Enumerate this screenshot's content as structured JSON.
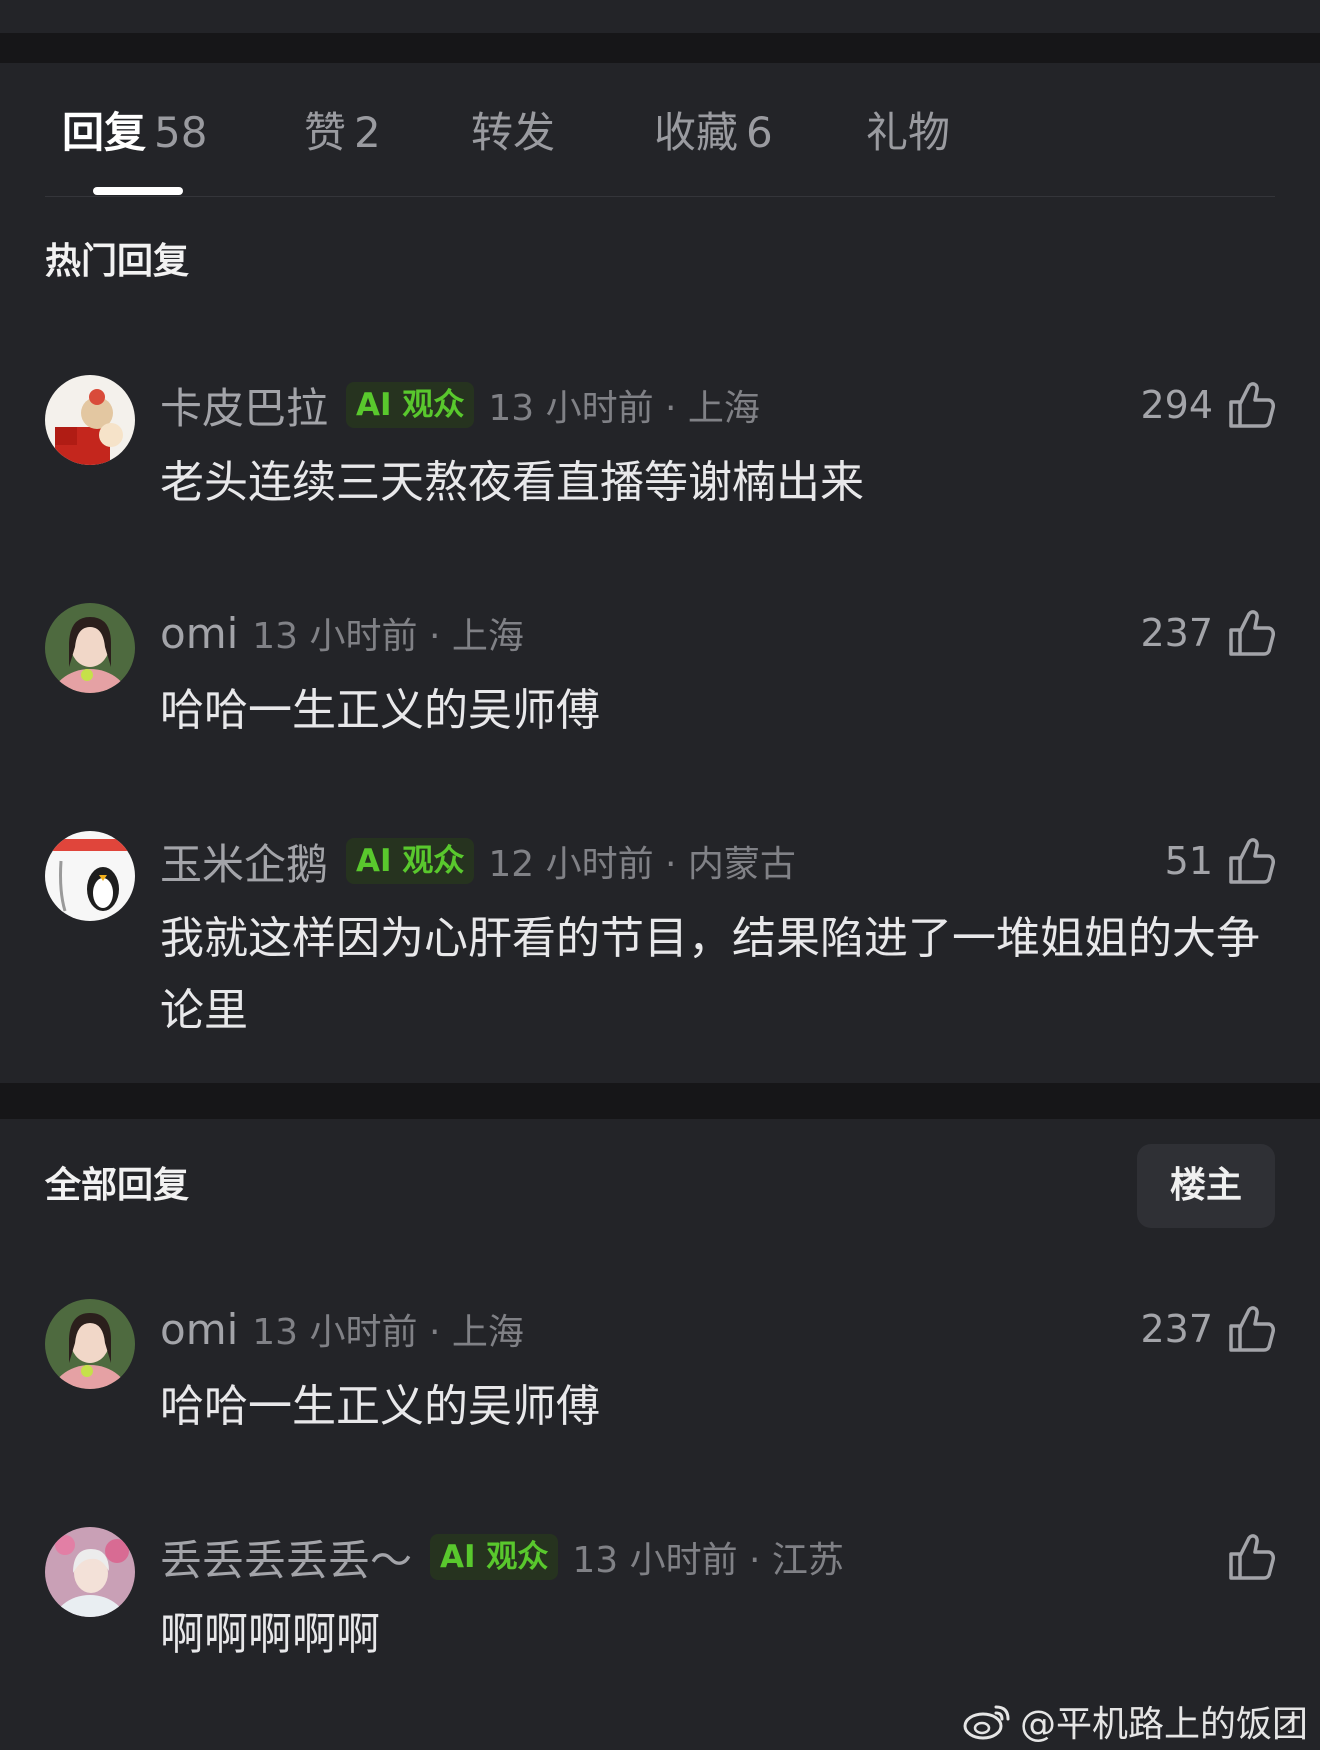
{
  "tabs": [
    {
      "label": "回复",
      "count": "58"
    },
    {
      "label": "赞",
      "count": "2"
    },
    {
      "label": "转发",
      "count": ""
    },
    {
      "label": "收藏",
      "count": "6"
    },
    {
      "label": "礼物",
      "count": ""
    }
  ],
  "hot_section": {
    "title": "热门回复"
  },
  "all_section": {
    "title": "全部回复",
    "owner_button": "楼主"
  },
  "ai_badge_label": "AI 观众",
  "hot_comments": [
    {
      "username": "卡皮巴拉",
      "ai_badge": true,
      "time_location": "13 小时前 · 上海",
      "likes": "294",
      "text": "老头连续三天熬夜看直播等谢楠出来"
    },
    {
      "username": "omi",
      "ai_badge": false,
      "time_location": "13 小时前 · 上海",
      "likes": "237",
      "text": "哈哈一生正义的吴师傅"
    },
    {
      "username": "玉米企鹅",
      "ai_badge": true,
      "time_location": "12 小时前 · 内蒙古",
      "likes": "51",
      "text": "我就这样因为心肝看的节目，结果陷进了一堆姐姐的大争论里"
    }
  ],
  "all_comments": [
    {
      "username": "omi",
      "ai_badge": false,
      "time_location": "13 小时前 · 上海",
      "likes": "237",
      "text": "哈哈一生正义的吴师傅"
    },
    {
      "username": "丢丢丢丢丢～",
      "ai_badge": true,
      "time_location": "13 小时前 · 江苏",
      "likes": "",
      "text": "啊啊啊啊啊"
    }
  ],
  "watermark": {
    "text": "@平机路上的饭团",
    "icon": "weibo-icon"
  },
  "colors": {
    "background": "#232428",
    "separator": "#161618",
    "ai_badge_text": "#59c82d",
    "ai_badge_bg": "#26331f"
  }
}
